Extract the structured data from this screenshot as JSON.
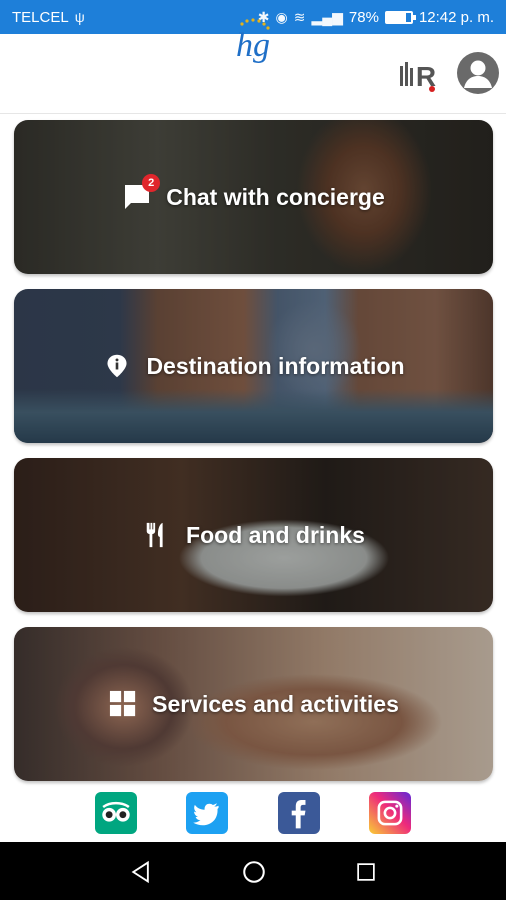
{
  "status_bar": {
    "carrier": "TELCEL",
    "battery_percent": "78%",
    "battery_level": 0.78,
    "time": "12:42 p. m."
  },
  "app_bar": {
    "logo_text": "hg",
    "partner_logo_text": "R"
  },
  "cards": [
    {
      "label": "Chat with concierge",
      "icon": "chat-icon",
      "badge": "2"
    },
    {
      "label": "Destination information",
      "icon": "info-pin-icon"
    },
    {
      "label": "Food and drinks",
      "icon": "fork-knife-icon"
    },
    {
      "label": "Services and activities",
      "icon": "grid-icon"
    }
  ],
  "social": [
    {
      "name": "tripadvisor-icon",
      "color": "#00a680"
    },
    {
      "name": "twitter-icon",
      "color": "#1da1f2"
    },
    {
      "name": "facebook-icon",
      "color": "#3b5998"
    },
    {
      "name": "instagram-icon",
      "color": "#d62976"
    }
  ],
  "colors": {
    "status_bar": "#1e7fd9",
    "badge": "#e0262c",
    "logo_blue": "#1f6fc7",
    "logo_gold": "#e3b21b"
  }
}
